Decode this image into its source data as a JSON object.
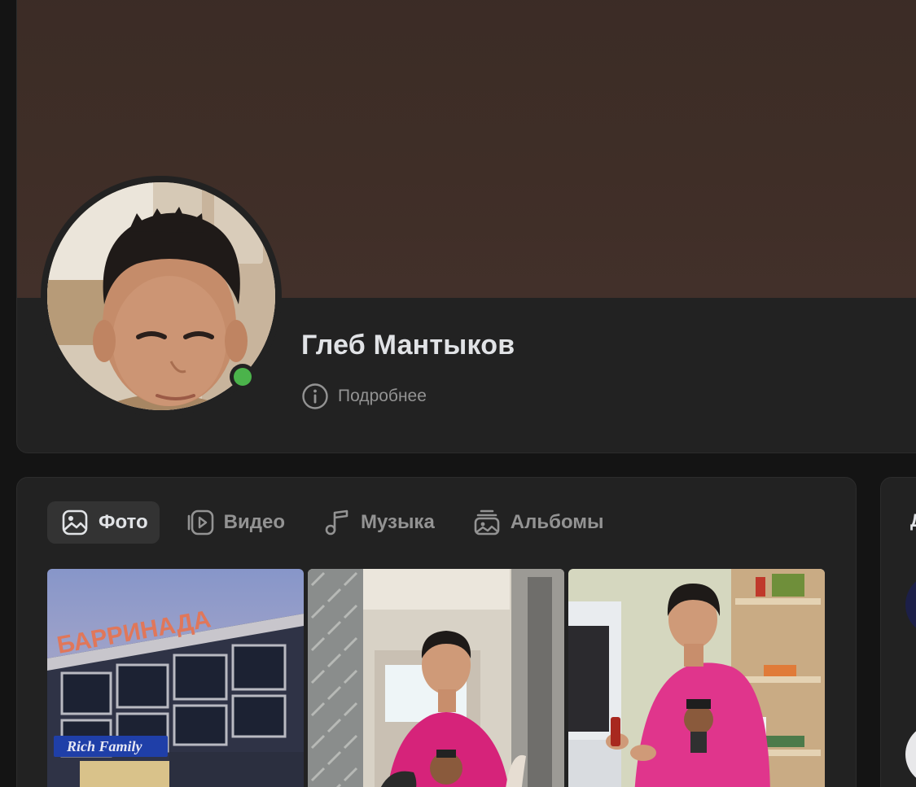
{
  "profile": {
    "name": "Глеб Мантыков",
    "details_label": "Подробнее",
    "online": true
  },
  "media": {
    "tabs": [
      {
        "label": "Фото",
        "icon": "photo-icon",
        "active": true
      },
      {
        "label": "Видео",
        "icon": "video-icon",
        "active": false
      },
      {
        "label": "Музыка",
        "icon": "music-icon",
        "active": false
      },
      {
        "label": "Альбомы",
        "icon": "albums-icon",
        "active": false
      }
    ],
    "photos": [
      {
        "sign_text": "БАРРИНАДА",
        "store_sign": "Rich Family"
      },
      {
        "shirt_text": ""
      },
      {
        "shirt_text": ""
      }
    ]
  },
  "side_card": {
    "title_fragment": "Д"
  },
  "colors": {
    "background": "#141414",
    "card": "#222222",
    "cover": "#3f2e27",
    "text_primary": "#e1e3e6",
    "text_secondary": "#939393",
    "online": "#4bb34b",
    "active_tab": "#333333"
  }
}
